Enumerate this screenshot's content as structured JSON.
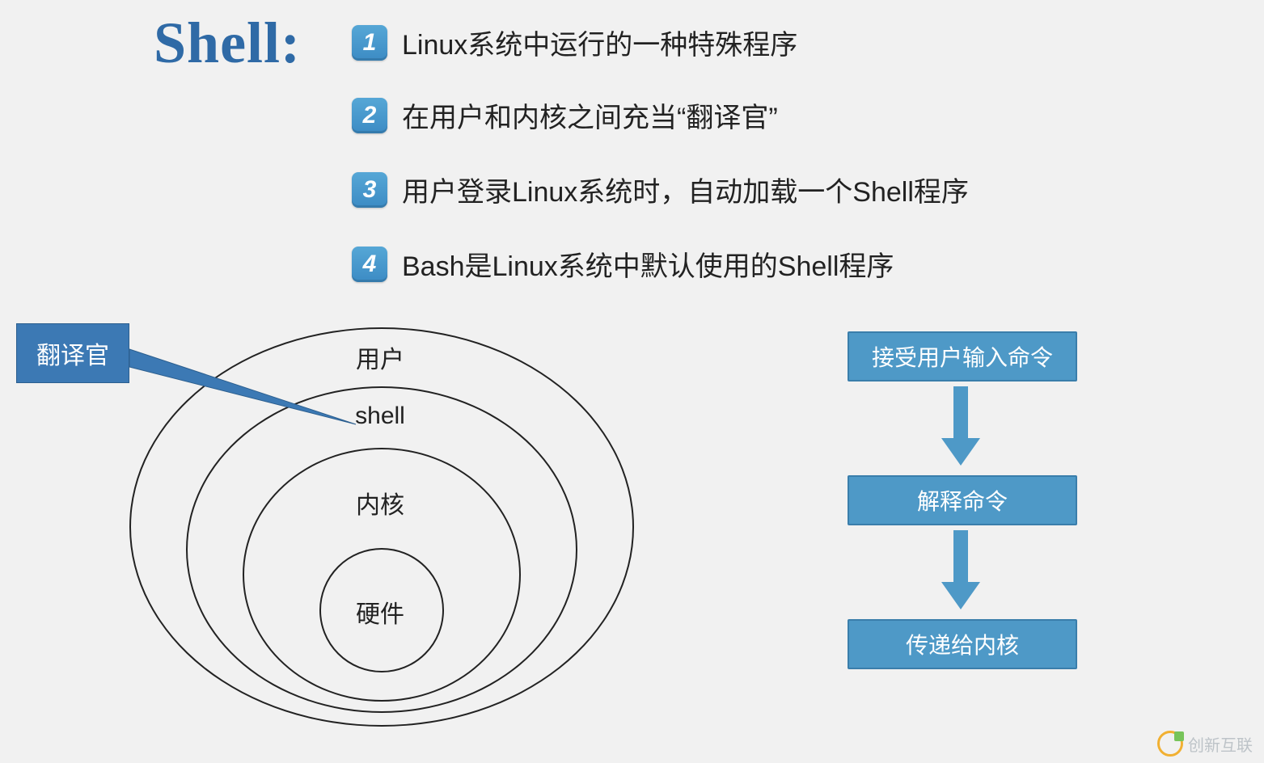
{
  "title": "Shell:",
  "bullets": [
    {
      "num": "1",
      "text": "Linux系统中运行的一种特殊程序"
    },
    {
      "num": "2",
      "text": "在用户和内核之间充当“翻译官”"
    },
    {
      "num": "3",
      "text": "用户登录Linux系统时，自动加载一个Shell程序"
    },
    {
      "num": "4",
      "text": "Bash是Linux系统中默认使用的Shell程序"
    }
  ],
  "callout": "翻译官",
  "layers": {
    "outer": "用户",
    "mid": "shell",
    "inner": "内核",
    "core": "硬件"
  },
  "flow": {
    "step1": "接受用户输入命令",
    "step2": "解释命令",
    "step3": "传递给内核"
  },
  "watermark": "创新互联",
  "colors": {
    "accent": "#4e99c7",
    "title": "#2f6aa6",
    "callout": "#3c79b4"
  }
}
